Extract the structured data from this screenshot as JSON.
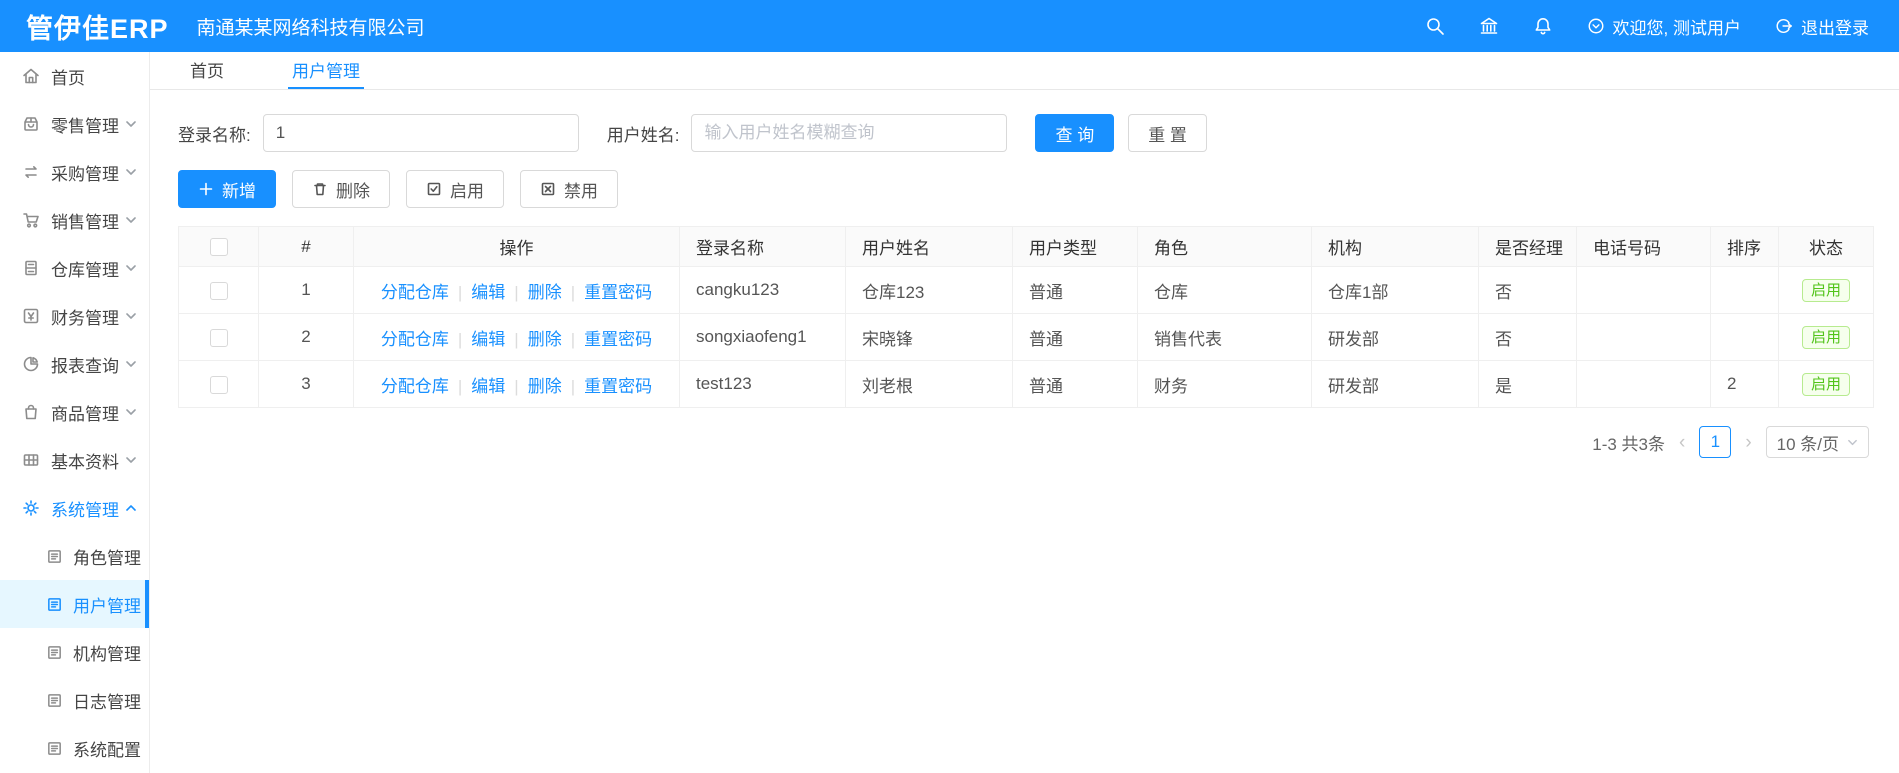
{
  "header": {
    "logo": "管伊佳ERP",
    "company": "南通某某网络科技有限公司",
    "welcome": "欢迎您, 测试用户",
    "logout": "退出登录"
  },
  "colors": {
    "primary": "#1890ff",
    "success": "#52c41a",
    "selected_bg": "#e6f7ff"
  },
  "sidebar": {
    "items": [
      {
        "label": "首页",
        "icon": "home"
      },
      {
        "label": "零售管理",
        "icon": "retail-shop"
      },
      {
        "label": "采购管理",
        "icon": "purchase-sync"
      },
      {
        "label": "销售管理",
        "icon": "sales-cart"
      },
      {
        "label": "仓库管理",
        "icon": "warehouse-cabinet"
      },
      {
        "label": "财务管理",
        "icon": "finance"
      },
      {
        "label": "报表查询",
        "icon": "report-pie"
      },
      {
        "label": "商品管理",
        "icon": "goods-bag"
      },
      {
        "label": "基本资料",
        "icon": "basic-grid"
      },
      {
        "label": "系统管理",
        "icon": "system-gear"
      }
    ],
    "sub_items": [
      {
        "label": "角色管理"
      },
      {
        "label": "用户管理",
        "selected": true
      },
      {
        "label": "机构管理"
      },
      {
        "label": "日志管理"
      },
      {
        "label": "系统配置"
      }
    ]
  },
  "tabs": [
    {
      "label": "首页"
    },
    {
      "label": "用户管理",
      "active": true
    }
  ],
  "search": {
    "login_label": "登录名称:",
    "login_value": "1",
    "name_label": "用户姓名:",
    "name_placeholder": "输入用户姓名模糊查询",
    "query_label": "查 询",
    "reset_label": "重 置"
  },
  "toolbar": {
    "add_label": "新增",
    "delete_label": "删除",
    "enable_label": "启用",
    "disable_label": "禁用"
  },
  "table": {
    "headers": {
      "index": "#",
      "ops": "操作",
      "login": "登录名称",
      "name": "用户姓名",
      "type": "用户类型",
      "role": "角色",
      "org": "机构",
      "manager": "是否经理",
      "phone": "电话号码",
      "sort": "排序",
      "status": "状态"
    },
    "op_labels": {
      "assign": "分配仓库",
      "edit": "编辑",
      "del": "删除",
      "reset_pwd": "重置密码"
    },
    "rows": [
      {
        "index": "1",
        "login": "cangku123",
        "name": "仓库123",
        "type": "普通",
        "role": "仓库",
        "org": "仓库1部",
        "manager": "否",
        "phone": "",
        "sort": "",
        "status": "启用"
      },
      {
        "index": "2",
        "login": "songxiaofeng1",
        "name": "宋晓锋",
        "type": "普通",
        "role": "销售代表",
        "org": "研发部",
        "manager": "否",
        "phone": "",
        "sort": "",
        "status": "启用"
      },
      {
        "index": "3",
        "login": "test123",
        "name": "刘老根",
        "type": "普通",
        "role": "财务",
        "org": "研发部",
        "manager": "是",
        "phone": "",
        "sort": "2",
        "status": "启用"
      }
    ]
  },
  "pagination": {
    "total_text": "1-3 共3条",
    "prev": "‹",
    "current_page": "1",
    "next": "›",
    "page_size": "10 条/页"
  }
}
